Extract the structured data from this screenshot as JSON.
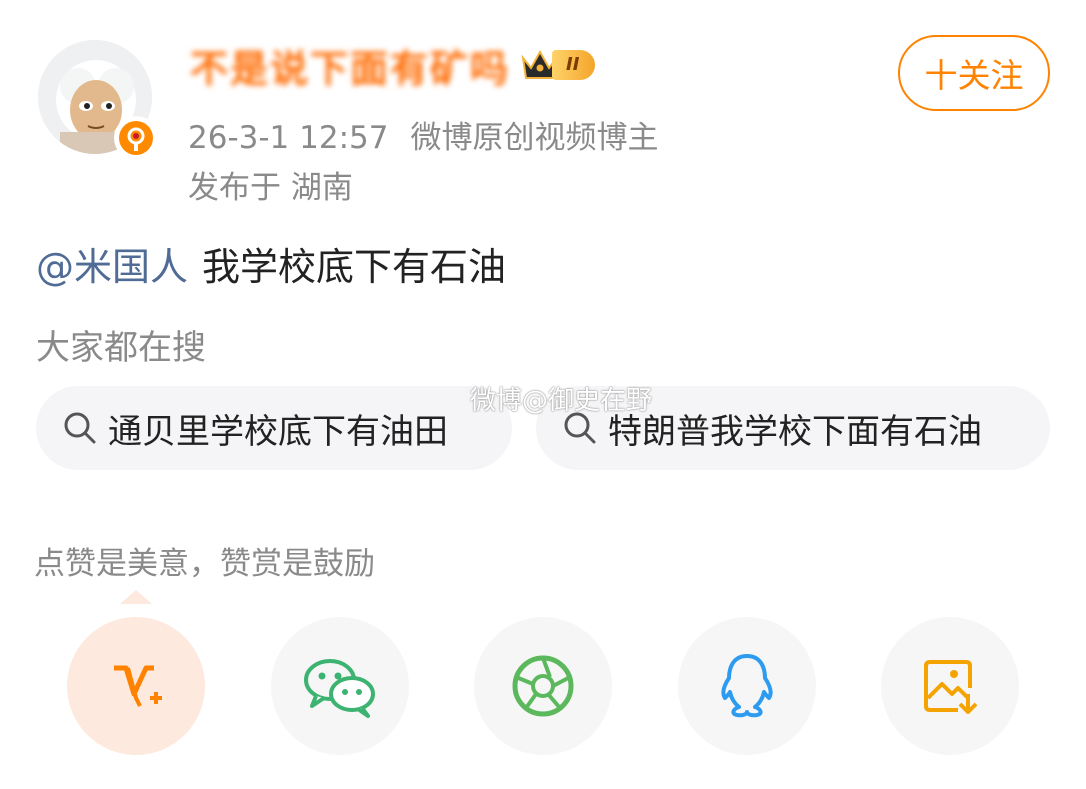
{
  "author": {
    "name": "不是说下面有矿吗",
    "level_badge": "II",
    "time": "26-3-1 12:57",
    "source": "微博原创视频博主",
    "location": "发布于 湖南"
  },
  "follow_button": "十关注",
  "post": {
    "mention": "@米国人",
    "text": "我学校底下有石油"
  },
  "search": {
    "title": "大家都在搜",
    "items": [
      "通贝里学校底下有油田",
      "特朗普我学校下面有石油"
    ]
  },
  "watermark": "微博@御史在野",
  "reward_text": "点赞是美意，赞赏是鼓励",
  "share_icons": [
    "vplus-icon",
    "wechat-icon",
    "moments-icon",
    "qq-icon",
    "save-image-icon"
  ],
  "colors": {
    "accent": "#ff8200",
    "mention": "#506c96",
    "wechat": "#3cb371",
    "qq": "#2d9cf0"
  }
}
